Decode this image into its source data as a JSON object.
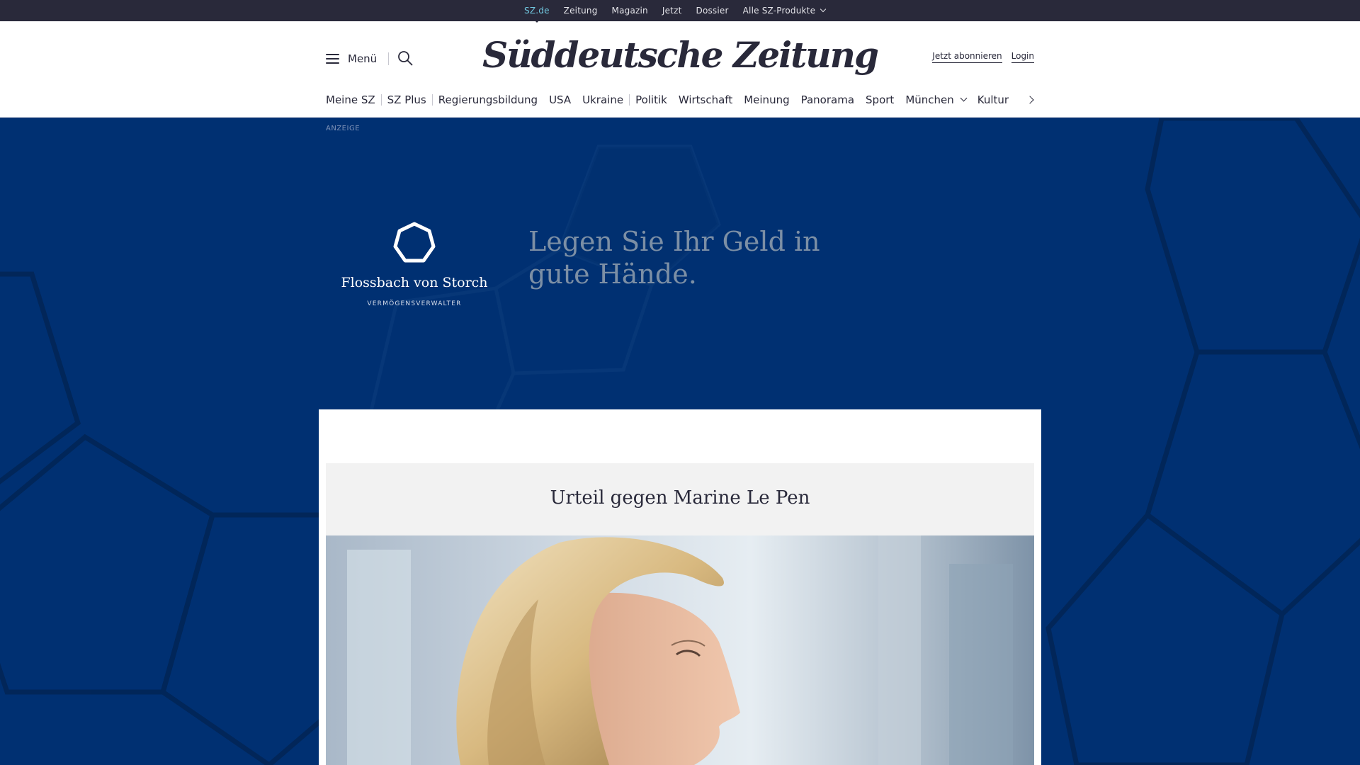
{
  "topbar": {
    "links": [
      "SZ.de",
      "Zeitung",
      "Magazin",
      "Jetzt",
      "Dossier",
      "Alle SZ-Produkte"
    ]
  },
  "header": {
    "menu_label": "Menü",
    "logo": "Süddeutsche Zeitung",
    "subscribe": "Jetzt abonnieren",
    "login": "Login"
  },
  "nav": {
    "items": [
      "Meine SZ",
      "SZ Plus",
      "Regierungsbildung",
      "USA",
      "Ukraine",
      "Politik",
      "Wirtschaft",
      "Meinung",
      "Panorama",
      "Sport",
      "München",
      "Kultur"
    ]
  },
  "ad": {
    "label": "ANZEIGE",
    "brand": "Flossbach von Storch",
    "brand_sub": "VERMÖGENSVERWALTER",
    "claim": "Legen Sie Ihr Geld in gute Hände."
  },
  "article": {
    "kicker": "Urteil gegen Marine Le Pen"
  },
  "colors": {
    "ad_background": "#003072",
    "topbar": "#29293a",
    "active_link": "#71c8e0"
  }
}
